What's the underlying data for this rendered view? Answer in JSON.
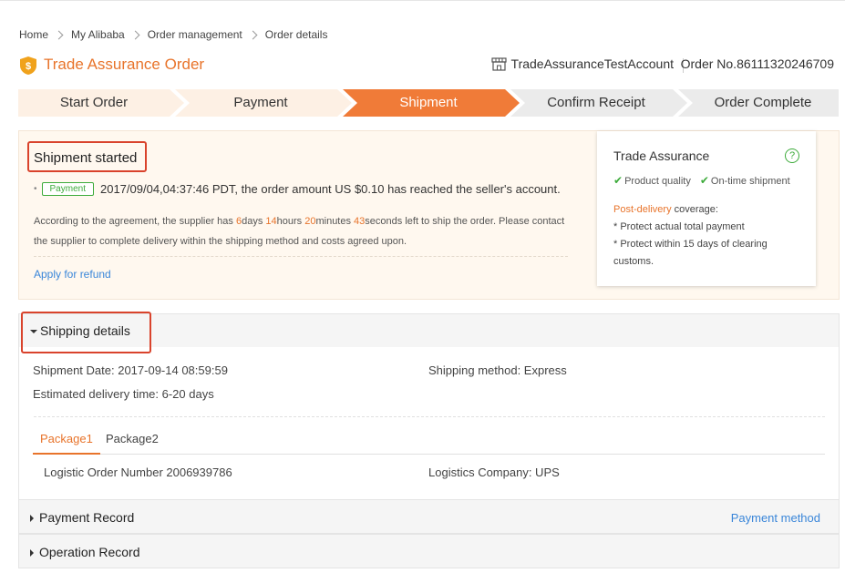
{
  "breadcrumb": [
    "Home",
    "My Alibaba",
    "Order management",
    "Order details"
  ],
  "header": {
    "title": "Trade Assurance Order",
    "seller": "TradeAssuranceTestAccount",
    "order_no": "Order No.86111320246709"
  },
  "steps": [
    "Start Order",
    "Payment",
    "Shipment",
    "Confirm Receipt",
    "Order Complete"
  ],
  "active_step": "Shipment",
  "status": {
    "title": "Shipment started",
    "badge": "Payment",
    "payment_message": "2017/09/04,04:37:46 PDT, the order amount US $0.10 has reached the seller's account.",
    "agreement_prefix": "According to the agreement, the supplier has ",
    "days": "6",
    "days_label": "days ",
    "hours": "14",
    "hours_label": "hours ",
    "minutes": "20",
    "minutes_label": "minutes ",
    "seconds": "43",
    "agreement_suffix": "seconds left to ship the order. Please contact the supplier to complete delivery within the shipping method and costs agreed upon.",
    "refund_link": "Apply for refund"
  },
  "trade_assurance": {
    "title": "Trade Assurance",
    "help": "?",
    "check1": "Product quality",
    "check2": "On-time shipment",
    "coverage_highlight": "Post-delivery",
    "coverage_label": " coverage:",
    "point1": "* Protect actual total payment",
    "point2": "* Protect within 15 days of clearing customs."
  },
  "shipping": {
    "title": "Shipping details",
    "shipment_date": "Shipment Date: 2017-09-14 08:59:59",
    "shipping_method": "Shipping method:  Express",
    "delivery_time": "Estimated delivery time:  6-20 days",
    "tabs": [
      "Package1",
      "Package2"
    ],
    "logistic_order": "Logistic Order Number 2006939786",
    "logistics_company": "Logistics Company: UPS"
  },
  "payment_record": {
    "title": "Payment Record",
    "link": "Payment method"
  },
  "operation_record": {
    "title": "Operation Record"
  },
  "colors": {
    "accent": "#e8742b",
    "link": "#3a86d9",
    "success": "#3dab3b",
    "highlight_box": "#d9432c"
  }
}
